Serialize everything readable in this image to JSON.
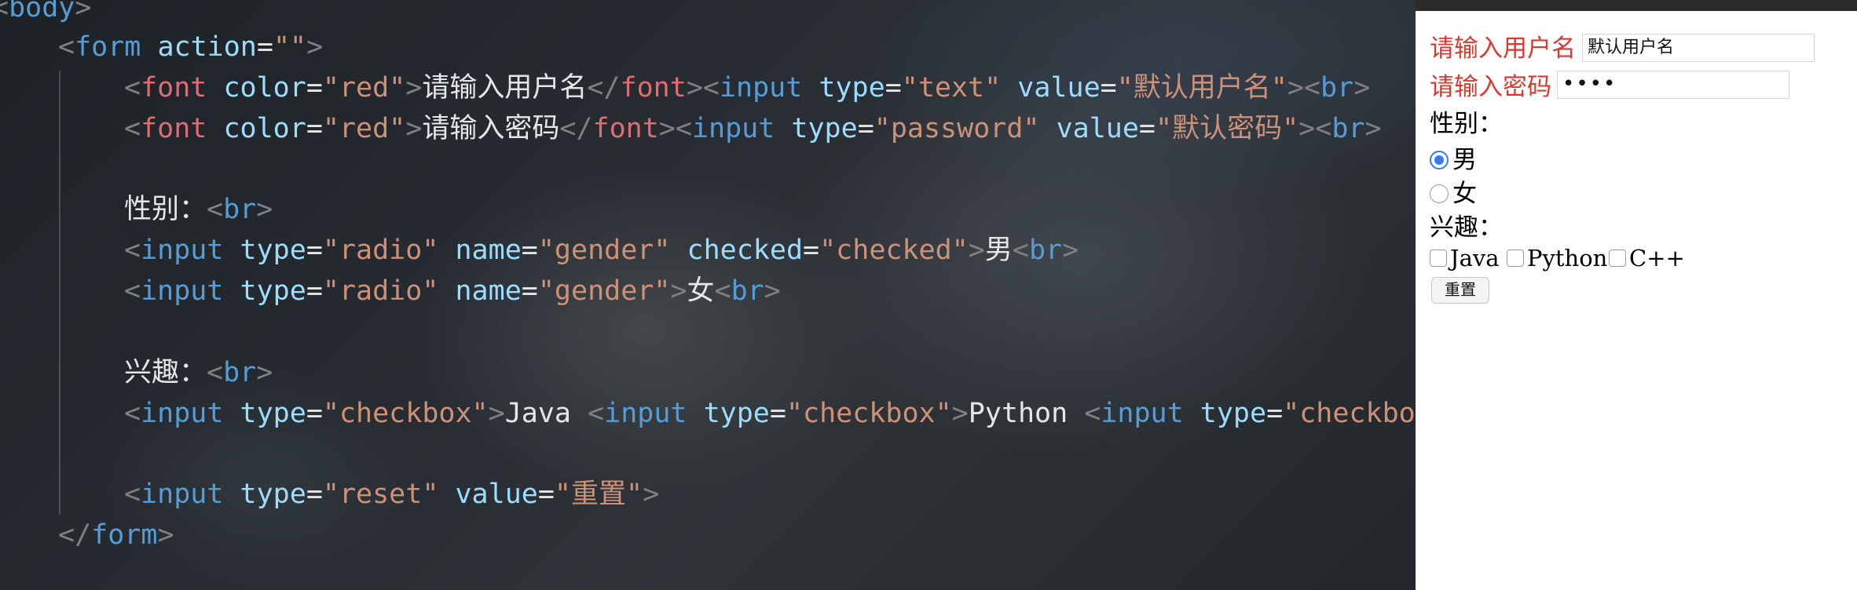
{
  "editor": {
    "lines": [
      {
        "tokens": [
          {
            "t": "<",
            "c": "p"
          },
          {
            "t": "body",
            "c": "tag"
          },
          {
            "t": ">",
            "c": "p"
          }
        ]
      },
      {
        "tokens": [
          {
            "t": "<",
            "c": "p"
          },
          {
            "t": "form",
            "c": "tag"
          },
          {
            "t": " ",
            "c": "txt"
          },
          {
            "t": "action",
            "c": "attr"
          },
          {
            "t": "=",
            "c": "txt"
          },
          {
            "t": "\"\"",
            "c": "str"
          },
          {
            "t": ">",
            "c": "p"
          }
        ]
      },
      {
        "tokens": [
          {
            "t": "<",
            "c": "p"
          },
          {
            "t": "font",
            "c": "red"
          },
          {
            "t": " ",
            "c": "txt"
          },
          {
            "t": "color",
            "c": "attr"
          },
          {
            "t": "=",
            "c": "txt"
          },
          {
            "t": "\"red\"",
            "c": "str"
          },
          {
            "t": ">",
            "c": "p"
          },
          {
            "t": "请输入用户名",
            "c": "txt"
          },
          {
            "t": "</",
            "c": "p"
          },
          {
            "t": "font",
            "c": "red"
          },
          {
            "t": ">",
            "c": "p"
          },
          {
            "t": "<",
            "c": "p"
          },
          {
            "t": "input",
            "c": "tag"
          },
          {
            "t": " ",
            "c": "txt"
          },
          {
            "t": "type",
            "c": "attr"
          },
          {
            "t": "=",
            "c": "txt"
          },
          {
            "t": "\"text\"",
            "c": "str"
          },
          {
            "t": " ",
            "c": "txt"
          },
          {
            "t": "value",
            "c": "attr"
          },
          {
            "t": "=",
            "c": "txt"
          },
          {
            "t": "\"默认用户名\"",
            "c": "str"
          },
          {
            "t": ">",
            "c": "p"
          },
          {
            "t": "<",
            "c": "p"
          },
          {
            "t": "br",
            "c": "tag"
          },
          {
            "t": ">",
            "c": "p"
          }
        ]
      },
      {
        "tokens": [
          {
            "t": "<",
            "c": "p"
          },
          {
            "t": "font",
            "c": "red"
          },
          {
            "t": " ",
            "c": "txt"
          },
          {
            "t": "color",
            "c": "attr"
          },
          {
            "t": "=",
            "c": "txt"
          },
          {
            "t": "\"red\"",
            "c": "str"
          },
          {
            "t": ">",
            "c": "p"
          },
          {
            "t": "请输入密码",
            "c": "txt"
          },
          {
            "t": "</",
            "c": "p"
          },
          {
            "t": "font",
            "c": "red"
          },
          {
            "t": ">",
            "c": "p"
          },
          {
            "t": "<",
            "c": "p"
          },
          {
            "t": "input",
            "c": "tag"
          },
          {
            "t": " ",
            "c": "txt"
          },
          {
            "t": "type",
            "c": "attr"
          },
          {
            "t": "=",
            "c": "txt"
          },
          {
            "t": "\"password\"",
            "c": "str"
          },
          {
            "t": " ",
            "c": "txt"
          },
          {
            "t": "value",
            "c": "attr"
          },
          {
            "t": "=",
            "c": "txt"
          },
          {
            "t": "\"默认密码\"",
            "c": "str"
          },
          {
            "t": ">",
            "c": "p"
          },
          {
            "t": "<",
            "c": "p"
          },
          {
            "t": "br",
            "c": "tag"
          },
          {
            "t": ">",
            "c": "p"
          }
        ]
      },
      {
        "tokens": [
          {
            "t": "性别：",
            "c": "txt"
          },
          {
            "t": "<",
            "c": "p"
          },
          {
            "t": "br",
            "c": "tag"
          },
          {
            "t": ">",
            "c": "p"
          }
        ]
      },
      {
        "tokens": [
          {
            "t": "<",
            "c": "p"
          },
          {
            "t": "input",
            "c": "tag"
          },
          {
            "t": " ",
            "c": "txt"
          },
          {
            "t": "type",
            "c": "attr"
          },
          {
            "t": "=",
            "c": "txt"
          },
          {
            "t": "\"radio\"",
            "c": "str"
          },
          {
            "t": " ",
            "c": "txt"
          },
          {
            "t": "name",
            "c": "attr"
          },
          {
            "t": "=",
            "c": "txt"
          },
          {
            "t": "\"gender\"",
            "c": "str"
          },
          {
            "t": " ",
            "c": "txt"
          },
          {
            "t": "checked",
            "c": "attr"
          },
          {
            "t": "=",
            "c": "txt"
          },
          {
            "t": "\"checked\"",
            "c": "str"
          },
          {
            "t": ">",
            "c": "p"
          },
          {
            "t": "男",
            "c": "txt"
          },
          {
            "t": "<",
            "c": "p"
          },
          {
            "t": "br",
            "c": "tag"
          },
          {
            "t": ">",
            "c": "p"
          }
        ]
      },
      {
        "tokens": [
          {
            "t": "<",
            "c": "p"
          },
          {
            "t": "input",
            "c": "tag"
          },
          {
            "t": " ",
            "c": "txt"
          },
          {
            "t": "type",
            "c": "attr"
          },
          {
            "t": "=",
            "c": "txt"
          },
          {
            "t": "\"radio\"",
            "c": "str"
          },
          {
            "t": " ",
            "c": "txt"
          },
          {
            "t": "name",
            "c": "attr"
          },
          {
            "t": "=",
            "c": "txt"
          },
          {
            "t": "\"gender\"",
            "c": "str"
          },
          {
            "t": ">",
            "c": "p"
          },
          {
            "t": "女",
            "c": "txt"
          },
          {
            "t": "<",
            "c": "p"
          },
          {
            "t": "br",
            "c": "tag"
          },
          {
            "t": ">",
            "c": "p"
          }
        ]
      },
      {
        "tokens": [
          {
            "t": "兴趣：",
            "c": "txt"
          },
          {
            "t": "<",
            "c": "p"
          },
          {
            "t": "br",
            "c": "tag"
          },
          {
            "t": ">",
            "c": "p"
          }
        ]
      },
      {
        "tokens": [
          {
            "t": "<",
            "c": "p"
          },
          {
            "t": "input",
            "c": "tag"
          },
          {
            "t": " ",
            "c": "txt"
          },
          {
            "t": "type",
            "c": "attr"
          },
          {
            "t": "=",
            "c": "txt"
          },
          {
            "t": "\"checkbox\"",
            "c": "str"
          },
          {
            "t": ">",
            "c": "p"
          },
          {
            "t": "Java ",
            "c": "txt"
          },
          {
            "t": "<",
            "c": "p"
          },
          {
            "t": "input",
            "c": "tag"
          },
          {
            "t": " ",
            "c": "txt"
          },
          {
            "t": "type",
            "c": "attr"
          },
          {
            "t": "=",
            "c": "txt"
          },
          {
            "t": "\"checkbox\"",
            "c": "str"
          },
          {
            "t": ">",
            "c": "p"
          },
          {
            "t": "Python ",
            "c": "txt"
          },
          {
            "t": "<",
            "c": "p"
          },
          {
            "t": "input",
            "c": "tag"
          },
          {
            "t": " ",
            "c": "txt"
          },
          {
            "t": "type",
            "c": "attr"
          },
          {
            "t": "=",
            "c": "txt"
          },
          {
            "t": "\"checkbox",
            "c": "str"
          }
        ]
      },
      {
        "tokens": [
          {
            "t": "<",
            "c": "p"
          },
          {
            "t": "input",
            "c": "tag"
          },
          {
            "t": " ",
            "c": "txt"
          },
          {
            "t": "type",
            "c": "attr"
          },
          {
            "t": "=",
            "c": "txt"
          },
          {
            "t": "\"reset\"",
            "c": "str"
          },
          {
            "t": " ",
            "c": "txt"
          },
          {
            "t": "value",
            "c": "attr"
          },
          {
            "t": "=",
            "c": "txt"
          },
          {
            "t": "\"重置\"",
            "c": "str"
          },
          {
            "t": ">",
            "c": "p"
          }
        ]
      },
      {
        "tokens": [
          {
            "t": "</",
            "c": "p"
          },
          {
            "t": "form",
            "c": "tag"
          },
          {
            "t": ">",
            "c": "p"
          }
        ]
      }
    ]
  },
  "preview": {
    "username_label": "请输入用户名",
    "username_value": "默认用户名",
    "password_label": "请输入密码",
    "password_value": "默认密码",
    "gender_label": "性别：",
    "gender_options": [
      {
        "label": "男",
        "checked": true
      },
      {
        "label": "女",
        "checked": false
      }
    ],
    "hobby_label": "兴趣：",
    "hobby_options": [
      "Java",
      "Python",
      "C++"
    ],
    "reset_label": "重置"
  },
  "colors": {
    "accent_red": "#d93a30",
    "radio_blue": "#3478f6"
  }
}
